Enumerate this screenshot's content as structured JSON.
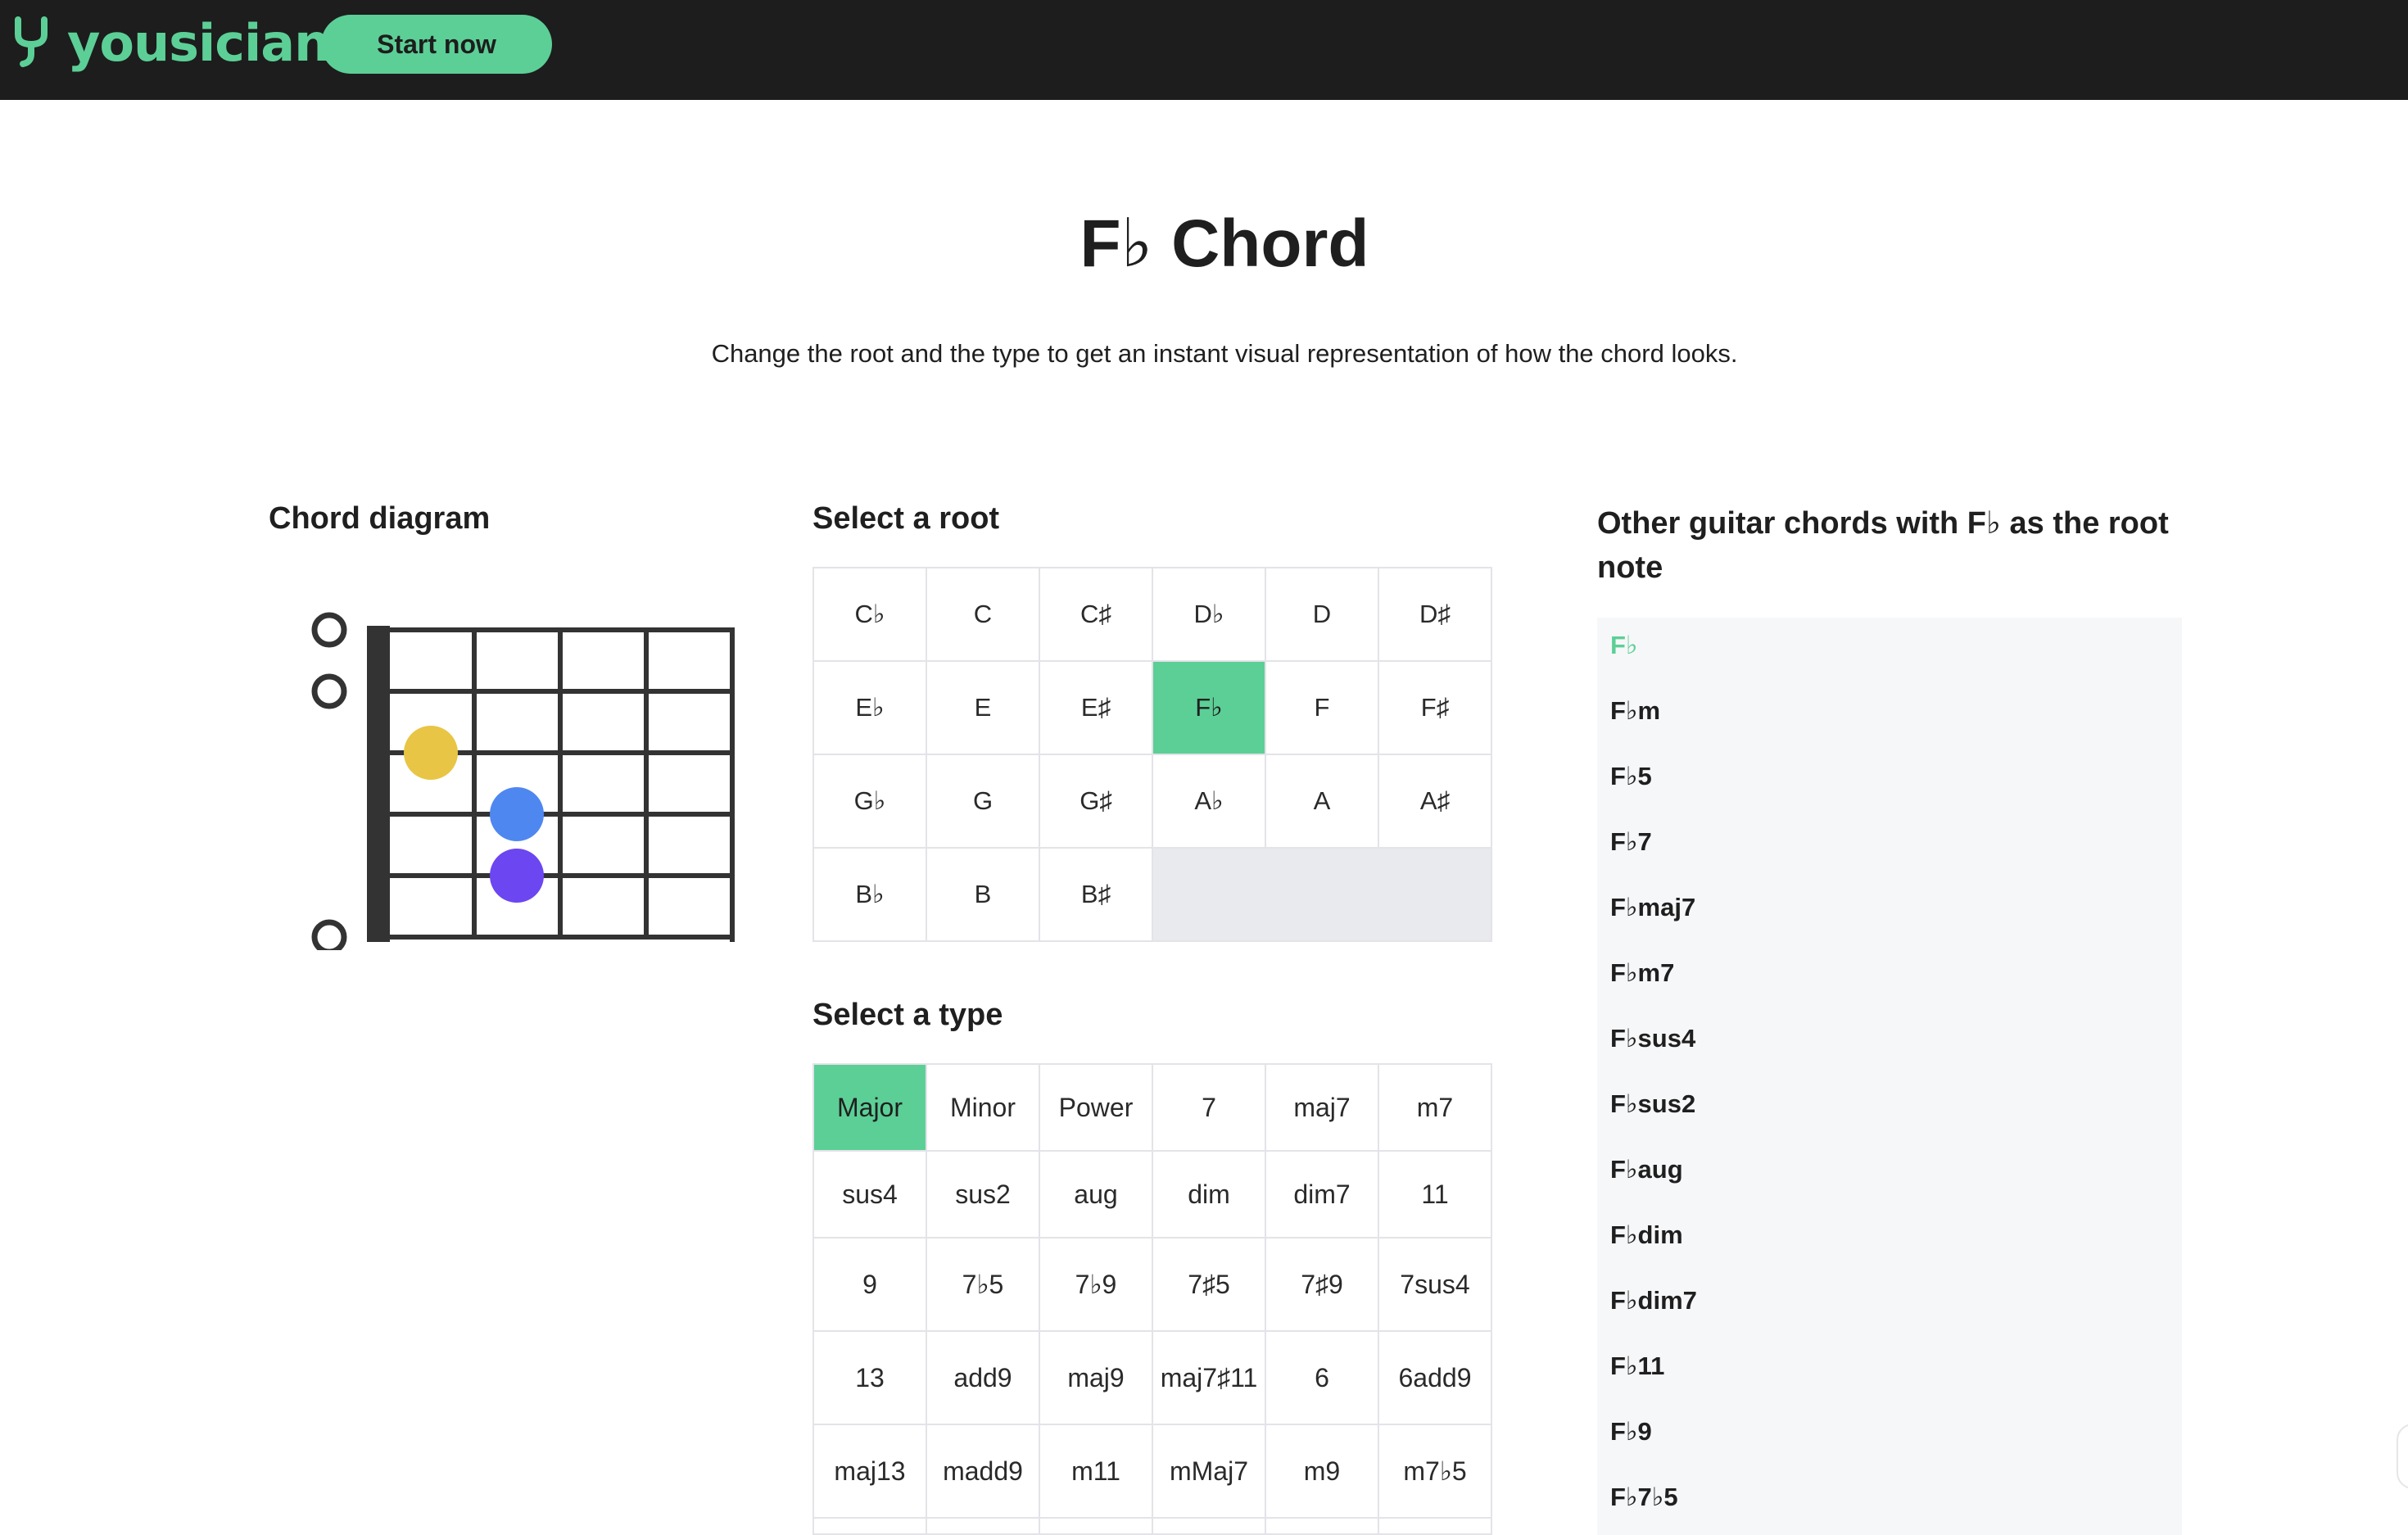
{
  "header": {
    "brand": "yousician",
    "cta_label": "Start now"
  },
  "hero": {
    "title": "F♭ Chord",
    "subtitle": "Change the root and the type to get an instant visual representation of how the chord looks."
  },
  "diagram": {
    "heading": "Chord diagram",
    "open_string_markers": 3,
    "finger_dots": [
      {
        "color": "#e8c545",
        "name": "yellow"
      },
      {
        "color": "#4f87f0",
        "name": "blue"
      },
      {
        "color": "#6c46f0",
        "name": "purple"
      }
    ]
  },
  "roots": {
    "heading": "Select a root",
    "selected": "F♭",
    "items": [
      "C♭",
      "C",
      "C♯",
      "D♭",
      "D",
      "D♯",
      "E♭",
      "E",
      "E♯",
      "F♭",
      "F",
      "F♯",
      "G♭",
      "G",
      "G♯",
      "A♭",
      "A",
      "A♯",
      "B♭",
      "B",
      "B♯"
    ]
  },
  "types": {
    "heading": "Select a type",
    "selected": "Major",
    "items": [
      "Major",
      "Minor",
      "Power",
      "7",
      "maj7",
      "m7",
      "sus4",
      "sus2",
      "aug",
      "dim",
      "dim7",
      "11",
      "9",
      "7♭5",
      "7♭9",
      "7♯5",
      "7♯9",
      "7sus4",
      "13",
      "add9",
      "maj9",
      "maj7♯11",
      "6",
      "6add9",
      "maj13",
      "madd9",
      "m11",
      "mMaj7",
      "m9",
      "m7♭5"
    ]
  },
  "other_chords": {
    "heading": "Other guitar chords with F♭ as the root note",
    "active": "F♭",
    "items": [
      "F♭",
      "F♭m",
      "F♭5",
      "F♭7",
      "F♭maj7",
      "F♭m7",
      "F♭sus4",
      "F♭sus2",
      "F♭aug",
      "F♭dim",
      "F♭dim7",
      "F♭11",
      "F♭9",
      "F♭7♭5"
    ]
  },
  "colors": {
    "accent": "#5ccf96",
    "header_bg": "#1d1d1d",
    "panel_bg": "#f6f7f9"
  }
}
